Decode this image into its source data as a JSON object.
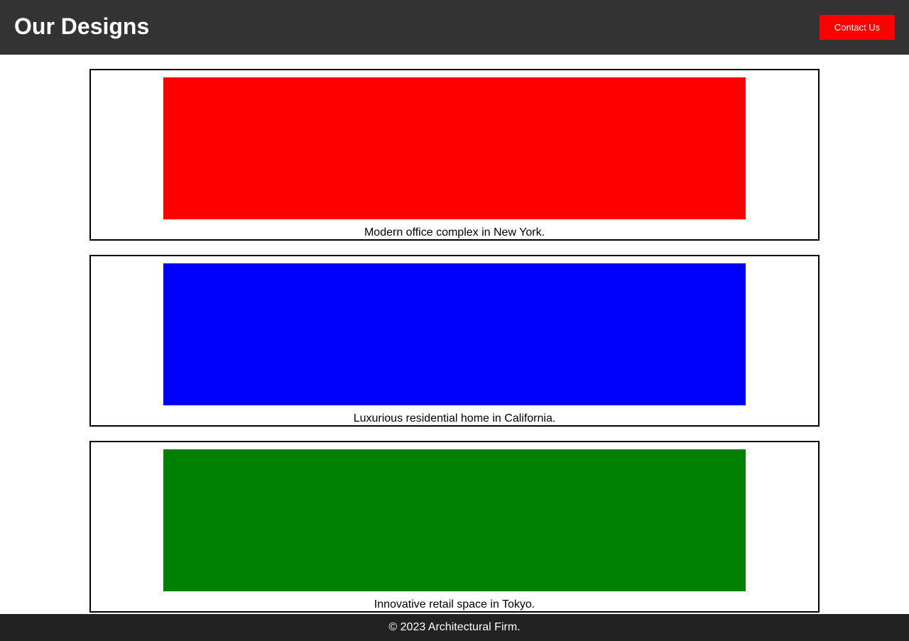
{
  "header": {
    "title": "Our Designs",
    "contact_label": "Contact Us"
  },
  "designs": [
    {
      "caption": "Modern office complex in New York.",
      "color": "#ff0000"
    },
    {
      "caption": "Luxurious residential home in California.",
      "color": "#0000ff"
    },
    {
      "caption": "Innovative retail space in Tokyo.",
      "color": "#008000"
    }
  ],
  "footer": {
    "copyright": "© 2023 Architectural Firm."
  },
  "colors": {
    "header_bg": "#333333",
    "footer_bg": "#222222",
    "accent": "#ff0000"
  }
}
